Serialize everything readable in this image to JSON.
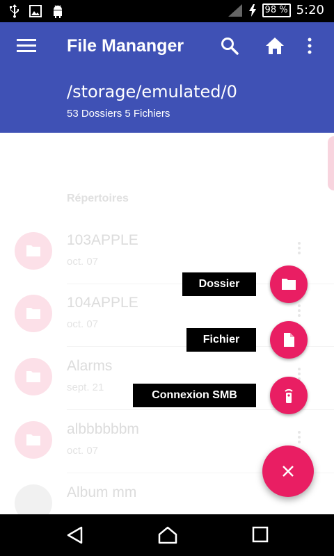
{
  "status_bar": {
    "battery": "98 %",
    "time": "5:20"
  },
  "header": {
    "title": "File Mananger",
    "path": "/storage/emulated/0",
    "counts": "53 Dossiers 5 Fichiers"
  },
  "section": {
    "title": "Répertoires"
  },
  "files": [
    {
      "name": "103APPLE",
      "date": "oct. 07"
    },
    {
      "name": "104APPLE",
      "date": "oct. 07"
    },
    {
      "name": "Alarms",
      "date": "sept. 21"
    },
    {
      "name": "albbbbbbm",
      "date": "oct. 07"
    },
    {
      "name": "Album mm",
      "date": ""
    }
  ],
  "fab_menu": {
    "folder_label": "Dossier",
    "file_label": "Fichier",
    "smb_label": "Connexion SMB"
  },
  "colors": {
    "primary": "#3f51b5",
    "accent": "#e91e63"
  },
  "icons": {
    "status": [
      "usb-icon",
      "image-icon",
      "android-icon",
      "signal-icon",
      "charging-icon"
    ],
    "toolbar": [
      "menu-icon",
      "search-icon",
      "home-icon",
      "more-vert-icon"
    ],
    "fab": [
      "folder-icon",
      "file-icon",
      "remote-icon",
      "close-icon"
    ],
    "nav": [
      "back-icon",
      "home-nav-icon",
      "recents-icon"
    ]
  }
}
